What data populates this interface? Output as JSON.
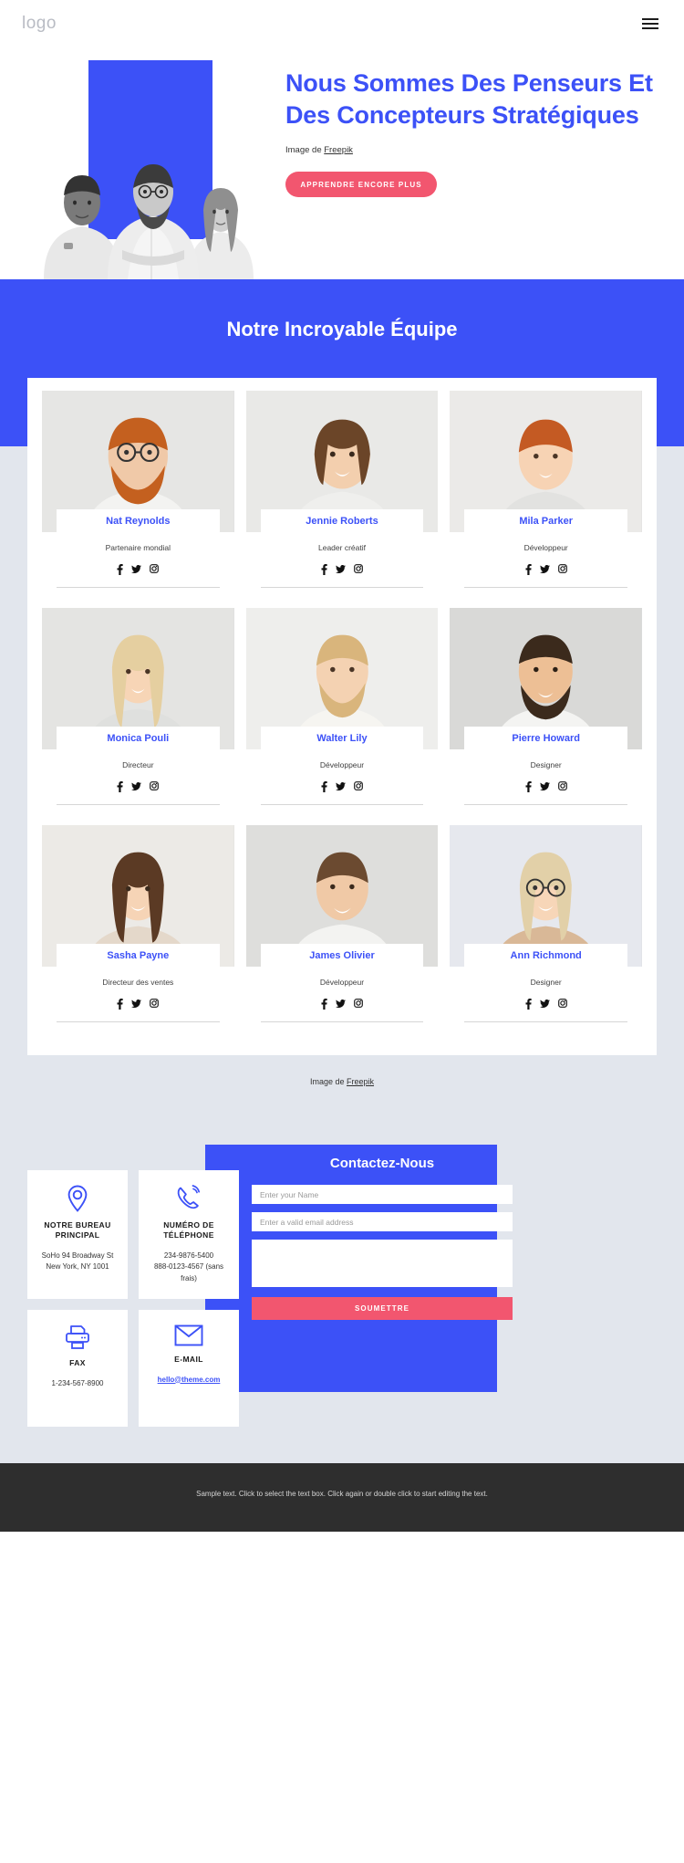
{
  "header": {
    "logo": "logo",
    "menu_icon": "hamburger-menu-icon"
  },
  "hero": {
    "title": "Nous Sommes Des Penseurs Et Des Concepteurs Stratégiques",
    "credit_prefix": "Image de ",
    "credit_link": "Freepik",
    "cta_label": "APPRENDRE ENCORE PLUS",
    "accent_color": "#3c51f7",
    "cta_color": "#f2566f"
  },
  "team": {
    "heading": "Notre Incroyable Équipe",
    "credit_prefix": "Image de ",
    "credit_link": "Freepik",
    "social_icons": [
      "facebook-icon",
      "twitter-icon",
      "instagram-icon"
    ],
    "members": [
      {
        "name": "Nat Reynolds",
        "role": "Partenaire mondial"
      },
      {
        "name": "Jennie Roberts",
        "role": "Leader créatif"
      },
      {
        "name": "Mila Parker",
        "role": "Développeur"
      },
      {
        "name": "Monica Pouli",
        "role": "Directeur"
      },
      {
        "name": "Walter Lily",
        "role": "Développeur"
      },
      {
        "name": "Pierre Howard",
        "role": "Designer"
      },
      {
        "name": "Sasha Payne",
        "role": "Directeur des ventes"
      },
      {
        "name": "James Olivier",
        "role": "Développeur"
      },
      {
        "name": "Ann Richmond",
        "role": "Designer"
      }
    ]
  },
  "contact": {
    "cards": [
      {
        "icon": "map-pin-icon",
        "title": "NOTRE BUREAU PRINCIPAL",
        "lines": [
          "SoHo 94 Broadway St",
          "New York, NY 1001"
        ],
        "link": null
      },
      {
        "icon": "phone-ring-icon",
        "title": "NUMÉRO DE TÉLÉPHONE",
        "lines": [
          "234-9876-5400",
          "888-0123-4567 (sans frais)"
        ],
        "link": null
      },
      {
        "icon": "printer-icon",
        "title": "FAX",
        "lines": [
          "1-234-567-8900"
        ],
        "link": null
      },
      {
        "icon": "envelope-icon",
        "title": "E-MAIL",
        "lines": [],
        "link": "hello@theme.com"
      }
    ],
    "form": {
      "title": "Contactez-Nous",
      "name_placeholder": "Enter your Name",
      "name_value": "",
      "email_placeholder": "Enter a valid email address",
      "email_value": "",
      "message_placeholder": "",
      "message_value": "",
      "submit_label": "SOUMETTRE"
    }
  },
  "footer": {
    "text": "Sample text. Click to select the text box. Click again or double click to start editing the text."
  }
}
